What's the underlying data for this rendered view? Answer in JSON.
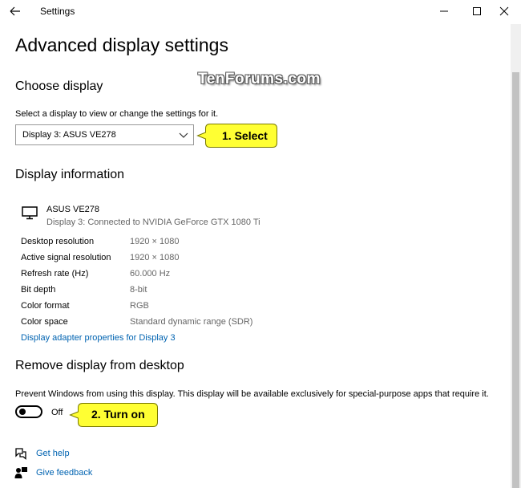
{
  "window": {
    "title": "Settings"
  },
  "page": {
    "title": "Advanced display settings",
    "watermark": "TenForums.com"
  },
  "choose_display": {
    "heading": "Choose display",
    "description": "Select a display to view or change the settings for it.",
    "selected": "Display 3: ASUS VE278",
    "callout": "1. Select"
  },
  "display_info": {
    "heading": "Display information",
    "monitor_name": "ASUS VE278",
    "monitor_desc": "Display 3: Connected to NVIDIA GeForce GTX 1080 Ti",
    "rows": [
      {
        "label": "Desktop resolution",
        "value": "1920 × 1080"
      },
      {
        "label": "Active signal resolution",
        "value": "1920 × 1080"
      },
      {
        "label": "Refresh rate (Hz)",
        "value": "60.000 Hz"
      },
      {
        "label": "Bit depth",
        "value": "8-bit"
      },
      {
        "label": "Color format",
        "value": "RGB"
      },
      {
        "label": "Color space",
        "value": "Standard dynamic range (SDR)"
      }
    ],
    "adapter_link": "Display adapter properties for Display 3"
  },
  "remove_display": {
    "heading": "Remove display from desktop",
    "description": "Prevent Windows from using this display. This display will be available exclusively for special-purpose apps that require it.",
    "toggle_state": "Off",
    "callout": "2. Turn on"
  },
  "footer": {
    "help": "Get help",
    "feedback": "Give feedback"
  },
  "icons": {
    "back": "back-arrow-icon",
    "minimize": "minimize-icon",
    "maximize": "maximize-icon",
    "close": "close-icon",
    "chevron": "chevron-down-icon",
    "monitor": "monitor-icon",
    "help": "help-icon",
    "feedback": "feedback-icon"
  },
  "colors": {
    "link": "#0063b1",
    "callout_fill": "#ffff33",
    "secondary_text": "#666666"
  }
}
